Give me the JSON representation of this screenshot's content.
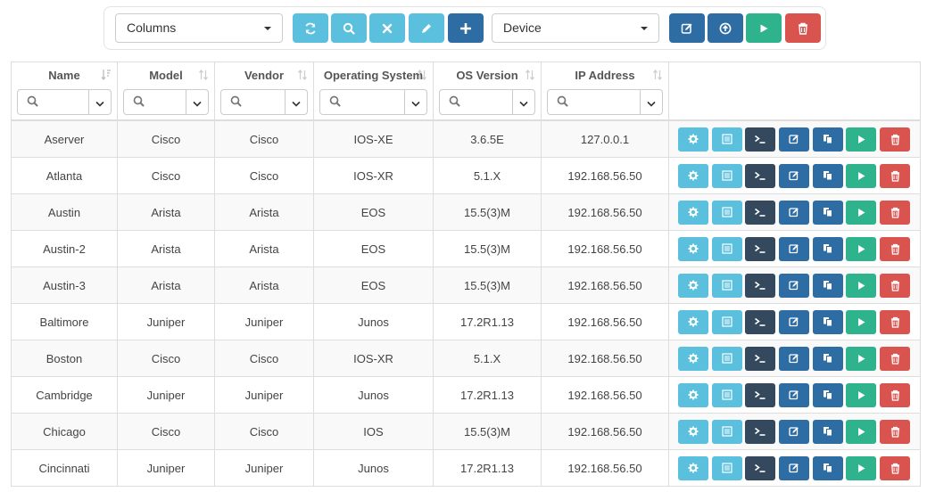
{
  "toolbar": {
    "columns_select": "Columns",
    "device_select": "Device"
  },
  "columns": [
    {
      "key": "name",
      "label": "Name"
    },
    {
      "key": "model",
      "label": "Model"
    },
    {
      "key": "vendor",
      "label": "Vendor"
    },
    {
      "key": "os",
      "label": "Operating System"
    },
    {
      "key": "os_version",
      "label": "OS Version"
    },
    {
      "key": "ip",
      "label": "IP Address"
    }
  ],
  "rows": [
    {
      "name": "Aserver",
      "model": "Cisco",
      "vendor": "Cisco",
      "os": "IOS-XE",
      "os_version": "3.6.5E",
      "ip": "127.0.0.1"
    },
    {
      "name": "Atlanta",
      "model": "Cisco",
      "vendor": "Cisco",
      "os": "IOS-XR",
      "os_version": "5.1.X",
      "ip": "192.168.56.50"
    },
    {
      "name": "Austin",
      "model": "Arista",
      "vendor": "Arista",
      "os": "EOS",
      "os_version": "15.5(3)M",
      "ip": "192.168.56.50"
    },
    {
      "name": "Austin-2",
      "model": "Arista",
      "vendor": "Arista",
      "os": "EOS",
      "os_version": "15.5(3)M",
      "ip": "192.168.56.50"
    },
    {
      "name": "Austin-3",
      "model": "Arista",
      "vendor": "Arista",
      "os": "EOS",
      "os_version": "15.5(3)M",
      "ip": "192.168.56.50"
    },
    {
      "name": "Baltimore",
      "model": "Juniper",
      "vendor": "Juniper",
      "os": "Junos",
      "os_version": "17.2R1.13",
      "ip": "192.168.56.50"
    },
    {
      "name": "Boston",
      "model": "Cisco",
      "vendor": "Cisco",
      "os": "IOS-XR",
      "os_version": "5.1.X",
      "ip": "192.168.56.50"
    },
    {
      "name": "Cambridge",
      "model": "Juniper",
      "vendor": "Juniper",
      "os": "Junos",
      "os_version": "17.2R1.13",
      "ip": "192.168.56.50"
    },
    {
      "name": "Chicago",
      "model": "Cisco",
      "vendor": "Cisco",
      "os": "IOS",
      "os_version": "15.5(3)M",
      "ip": "192.168.56.50"
    },
    {
      "name": "Cincinnati",
      "model": "Juniper",
      "vendor": "Juniper",
      "os": "Junos",
      "os_version": "17.2R1.13",
      "ip": "192.168.56.50"
    }
  ],
  "row_actions": [
    {
      "icon": "gear-icon",
      "color": "#5bc0de"
    },
    {
      "icon": "list-icon",
      "color": "#5bc0de"
    },
    {
      "icon": "terminal-icon",
      "color": "#34495e"
    },
    {
      "icon": "edit-icon",
      "color": "#2e6da4"
    },
    {
      "icon": "duplicate-icon",
      "color": "#2e6da4"
    },
    {
      "icon": "play-icon",
      "color": "#2fb38c"
    },
    {
      "icon": "trash-icon",
      "color": "#d9534f"
    }
  ],
  "colors": {
    "info": "#5bc0de",
    "primary": "#2e6da4",
    "dark": "#34495e",
    "success": "#2fb38c",
    "danger": "#d9534f"
  }
}
